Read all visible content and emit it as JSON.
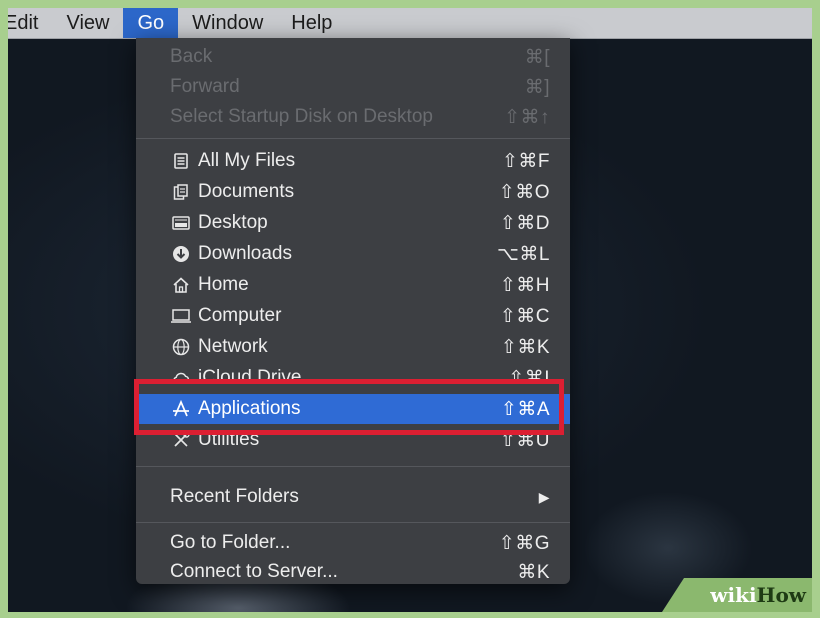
{
  "menubar": {
    "items": [
      "Edit",
      "View",
      "Go",
      "Window",
      "Help"
    ],
    "active_index": 2
  },
  "go_menu": {
    "navigation": [
      {
        "label": "Back",
        "shortcut": "⌘[",
        "enabled": false
      },
      {
        "label": "Forward",
        "shortcut": "⌘]",
        "enabled": false
      },
      {
        "label": "Select Startup Disk on Desktop",
        "shortcut": "⇧⌘↑",
        "enabled": false
      }
    ],
    "places": [
      {
        "label": "All My Files",
        "shortcut": "⇧⌘F",
        "icon": "all-my-files-icon"
      },
      {
        "label": "Documents",
        "shortcut": "⇧⌘O",
        "icon": "documents-icon"
      },
      {
        "label": "Desktop",
        "shortcut": "⇧⌘D",
        "icon": "desktop-icon"
      },
      {
        "label": "Downloads",
        "shortcut": "⌥⌘L",
        "icon": "downloads-icon"
      },
      {
        "label": "Home",
        "shortcut": "⇧⌘H",
        "icon": "home-icon"
      },
      {
        "label": "Computer",
        "shortcut": "⇧⌘C",
        "icon": "computer-icon"
      },
      {
        "label": "Network",
        "shortcut": "⇧⌘K",
        "icon": "network-icon"
      },
      {
        "label": "iCloud Drive",
        "shortcut": "⇧⌘I",
        "icon": "icloud-icon"
      },
      {
        "label": "Applications",
        "shortcut": "⇧⌘A",
        "icon": "applications-icon",
        "selected": true
      },
      {
        "label": "Utilities",
        "shortcut": "⇧⌘U",
        "icon": "utilities-icon"
      }
    ],
    "recent_folders": {
      "label": "Recent Folders",
      "submenu_indicator": "▶"
    },
    "folder_actions": [
      {
        "label": "Go to Folder...",
        "shortcut": "⇧⌘G"
      },
      {
        "label": "Connect to Server...",
        "shortcut": "⌘K"
      }
    ]
  },
  "watermark": {
    "part1": "wiki",
    "part2": "How"
  },
  "colors": {
    "menu_bg": "#3d3f43",
    "selection": "#2f6bd5",
    "highlight_border": "#dc1f32",
    "menubar_active": "#2c67c9"
  }
}
